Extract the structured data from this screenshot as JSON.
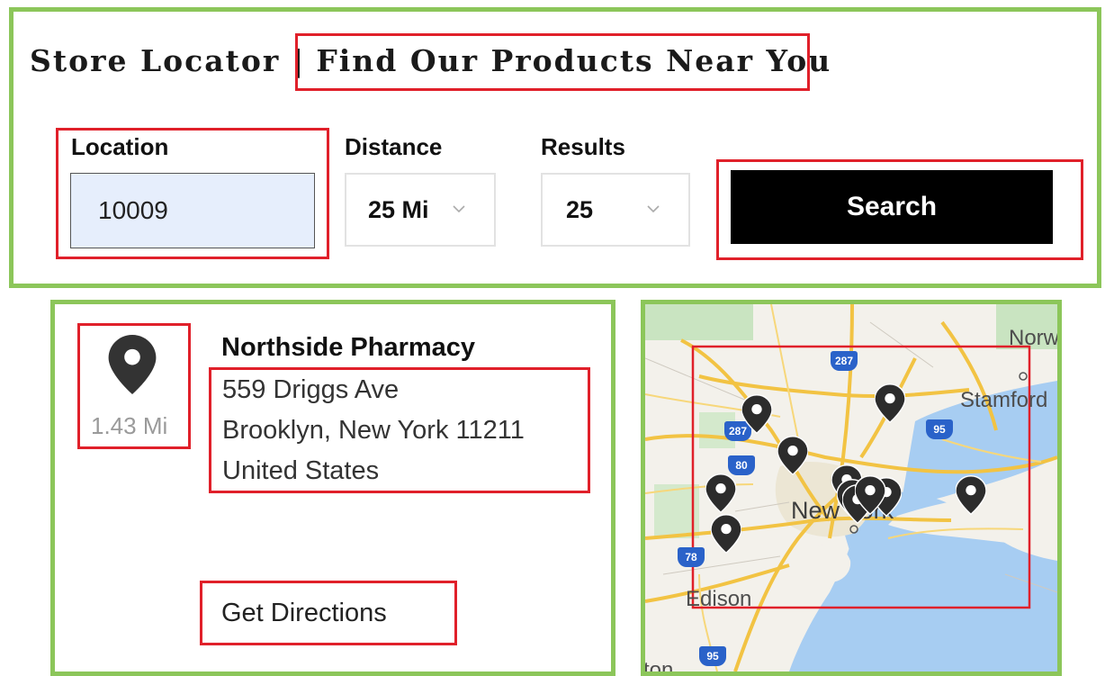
{
  "header": {
    "title": "Store Locator",
    "separator": "|",
    "subtitle": "Find Our Products Near You"
  },
  "search_form": {
    "location": {
      "label": "Location",
      "value": "10009"
    },
    "distance": {
      "label": "Distance",
      "selected": "25 Mi"
    },
    "results": {
      "label": "Results",
      "selected": "25"
    },
    "search_button_label": "Search"
  },
  "result": {
    "name": "Northside Pharmacy",
    "distance": "1.43 Mi",
    "address_line1": "559 Driggs Ave",
    "address_line2": "Brooklyn, New York 11211",
    "address_line3": "United States",
    "directions_label": "Get Directions"
  },
  "map": {
    "labels": {
      "norwalk": "Norw",
      "stamford": "Stamford",
      "new_york": "New York",
      "edison": "Edison",
      "bottom": "ton"
    },
    "shields": {
      "i287_top": "287",
      "i287_left": "287",
      "i80": "80",
      "i95_right": "95",
      "i78": "78",
      "i95_bottom": "95"
    },
    "marker_count": 11
  },
  "colors": {
    "panel_border": "#8cc65a",
    "highlight_border": "#e0202a",
    "button_bg": "#000000",
    "input_bg": "#e6eefc",
    "marker": "#2c2c2c",
    "water": "#a7cdf2",
    "land": "#f3f1eb",
    "highway": "#f2c343"
  }
}
